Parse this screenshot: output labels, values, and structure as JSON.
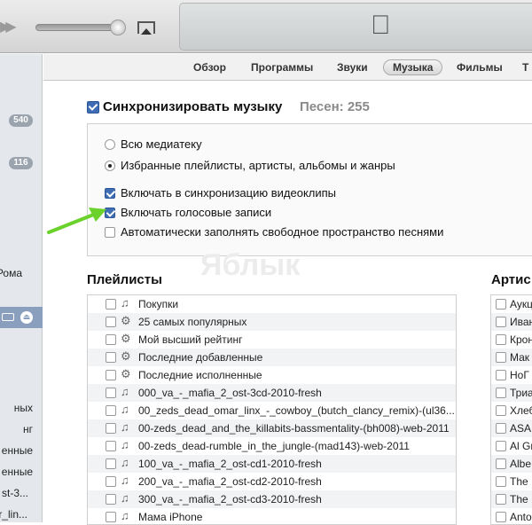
{
  "toolbar": {
    "airplay_icon": "airplay-icon",
    "apple_logo": "apple-logo"
  },
  "sidebar": {
    "badges": [
      "540",
      "116"
    ],
    "items": [
      "Рома",
      "ных",
      "нг",
      "енные",
      "енные",
      "st-3...",
      "r_lin..."
    ]
  },
  "tabs": [
    {
      "label": "Обзор"
    },
    {
      "label": "Программы"
    },
    {
      "label": "Звуки"
    },
    {
      "label": "Музыка",
      "active": true
    },
    {
      "label": "Фильмы"
    },
    {
      "label": "Т"
    }
  ],
  "sync": {
    "label": "Синхронизировать музыку",
    "checked": true,
    "count": "Песен: 255",
    "options": [
      {
        "label": "Всю медиатеку",
        "selected": false
      },
      {
        "label": "Избранные плейлисты, артисты, альбомы и жанры",
        "selected": true
      }
    ],
    "checks": [
      {
        "label": "Включать в синхронизацию видеоклипы",
        "checked": true
      },
      {
        "label": "Включать голосовые записи",
        "checked": true
      },
      {
        "label": "Автоматически заполнять свободное пространство песнями",
        "checked": false
      }
    ]
  },
  "watermark": "Яблык",
  "playlists": {
    "title": "Плейлисты",
    "items": [
      {
        "icon": "playlist",
        "label": "Покупки"
      },
      {
        "icon": "smart",
        "label": "25 самых популярных"
      },
      {
        "icon": "smart",
        "label": "Мой высший рейтинг"
      },
      {
        "icon": "smart",
        "label": "Последние добавленные"
      },
      {
        "icon": "smart",
        "label": "Последние исполненные"
      },
      {
        "icon": "playlist",
        "label": "000_va_-_mafia_2_ost-3cd-2010-fresh"
      },
      {
        "icon": "playlist",
        "label": "00_zeds_dead_omar_linx_-_cowboy_(butch_clancy_remix)-(ul36..."
      },
      {
        "icon": "playlist",
        "label": "00-zeds_dead_and_the_killabits-bassmentality-(bh008)-web-2011"
      },
      {
        "icon": "playlist",
        "label": "00-zeds_dead-rumble_in_the_jungle-(mad143)-web-2011"
      },
      {
        "icon": "playlist",
        "label": "100_va_-_mafia_2_ost-cd1-2010-fresh"
      },
      {
        "icon": "playlist",
        "label": "200_va_-_mafia_2_ost-cd2-2010-fresh"
      },
      {
        "icon": "playlist",
        "label": "300_va_-_mafia_2_ost-cd3-2010-fresh"
      },
      {
        "icon": "playlist",
        "label": "Мама iPhone"
      }
    ]
  },
  "artists": {
    "title": "Артис",
    "items": [
      "Аукц",
      "Иван",
      "Крон",
      "Мак",
      "НоГ",
      "Триа",
      "Хлеб",
      "ASAI",
      "Al Gr",
      "Albe",
      "The",
      "The",
      "Anto"
    ]
  }
}
